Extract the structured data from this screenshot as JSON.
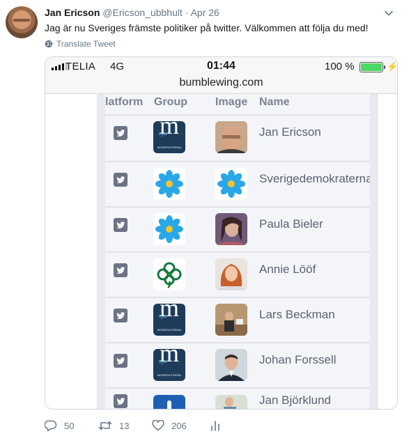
{
  "tweet": {
    "author": "Jan Ericson",
    "handle": "@Ericson_ubbhult",
    "separator": "·",
    "date": "Apr 26",
    "text": "Jag är nu Sveriges främste politiker på twitter. Välkommen att följa du med!",
    "translate_label": "Translate Tweet"
  },
  "phone": {
    "carrier": "TELIA",
    "network": "4G",
    "time": "01:44",
    "battery_percent": "100 %",
    "url": "bumblewing.com"
  },
  "table": {
    "headers": {
      "platform": "latform",
      "group": "Group",
      "image": "Image",
      "name": "Name"
    },
    "rows": [
      {
        "group": "moderaterna-logo",
        "image": "portrait-photo",
        "name": "Jan Ericson"
      },
      {
        "group": "sd-flower-logo",
        "image": "sd-flower-logo",
        "name": "Sverigedemokraterna"
      },
      {
        "group": "sd-flower-logo",
        "image": "portrait-photo",
        "name": "Paula Bieler"
      },
      {
        "group": "centerpartiet-clover-logo",
        "image": "portrait-photo",
        "name": "Annie Lööf"
      },
      {
        "group": "moderaterna-logo",
        "image": "portrait-photo",
        "name": "Lars Beckman"
      },
      {
        "group": "moderaterna-logo",
        "image": "portrait-photo",
        "name": "Johan Forssell"
      },
      {
        "group": "liberalerna-logo",
        "image": "portrait-photo",
        "name": "Jan Björklund"
      }
    ],
    "moderaterna_logo": {
      "ny": "nya",
      "letter": "m",
      "caption": "MODERATERNA"
    }
  },
  "actions": {
    "replies": "50",
    "retweets": "13",
    "likes": "206"
  },
  "colors": {
    "text": "#14171a",
    "muted": "#657786",
    "moderaterna": "#1e3c5a",
    "sd_blue": "#2aa7e8",
    "sd_yellow": "#f4c52a",
    "centerpartiet_green": "#0f7a3a",
    "battery_green": "#4cd964"
  }
}
